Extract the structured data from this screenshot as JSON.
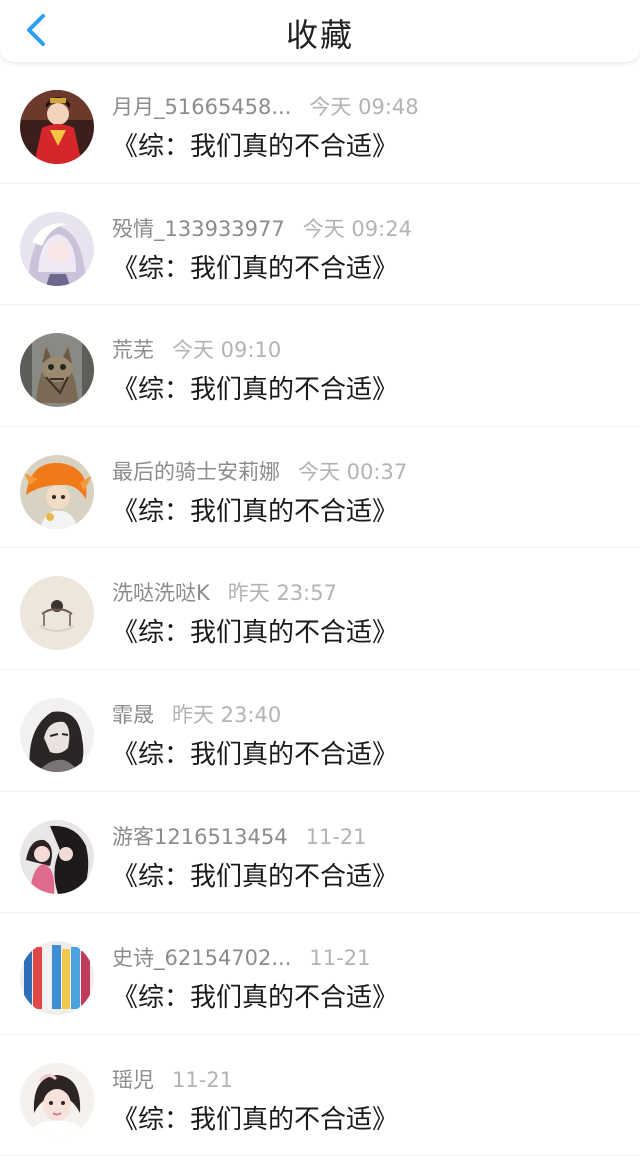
{
  "header": {
    "title": "收藏",
    "back_icon": "chevron-left-icon",
    "accent": "#2a9df4"
  },
  "items": [
    {
      "name": "月月_51665458...",
      "time": "今天 09:48",
      "title": "《综：我们真的不合适》",
      "avatar": "avatar-red-dress"
    },
    {
      "name": "殁情_133933977",
      "time": "今天 09:24",
      "title": "《综：我们真的不合适》",
      "avatar": "avatar-silver-hair"
    },
    {
      "name": "荒芜",
      "time": "今天 09:10",
      "title": "《综：我们真的不合适》",
      "avatar": "avatar-cat"
    },
    {
      "name": "最后的骑士安莉娜",
      "time": "今天 00:37",
      "title": "《综：我们真的不合适》",
      "avatar": "avatar-orange-hair"
    },
    {
      "name": "洗哒洗哒K",
      "time": "昨天 23:57",
      "title": "《综：我们真的不合适》",
      "avatar": "avatar-ornament"
    },
    {
      "name": "霏晟",
      "time": "昨天 23:40",
      "title": "《综：我们真的不合适》",
      "avatar": "avatar-anime-sketch"
    },
    {
      "name": "游客1216513454",
      "time": "11-21",
      "title": "《综：我们真的不合适》",
      "avatar": "avatar-anime-couple"
    },
    {
      "name": "史诗_62154702...",
      "time": "11-21",
      "title": "《综：我们真的不合适》",
      "avatar": "avatar-bookshelf"
    },
    {
      "name": "瑶児",
      "time": "11-21",
      "title": "《综：我们真的不合适》",
      "avatar": "avatar-girl-portrait"
    }
  ]
}
